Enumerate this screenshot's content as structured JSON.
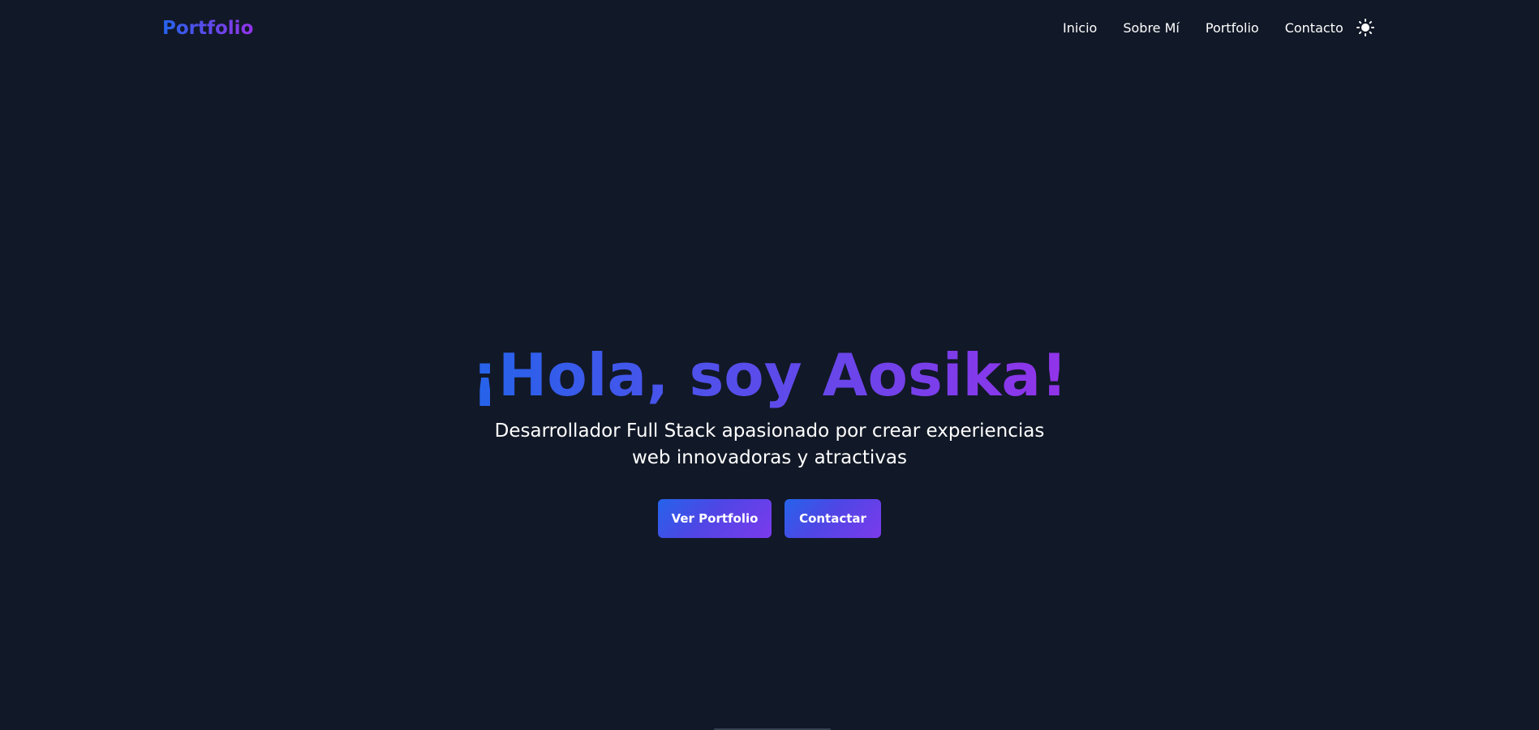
{
  "nav": {
    "logo": "Portfolio",
    "links": [
      "Inicio",
      "Sobre Mí",
      "Portfolio",
      "Contacto"
    ],
    "theme_icon": "sun-icon"
  },
  "hero": {
    "title": "¡Hola, soy Aosika!",
    "subtitle": "Desarrollador Full Stack apasionado por crear experiencias web innovadoras y atractivas",
    "buttons": [
      "Ver Portfolio",
      "Contactar"
    ]
  },
  "colors": {
    "background": "#111827",
    "gradient_start": "#2563eb",
    "gradient_end": "#9333ea"
  }
}
